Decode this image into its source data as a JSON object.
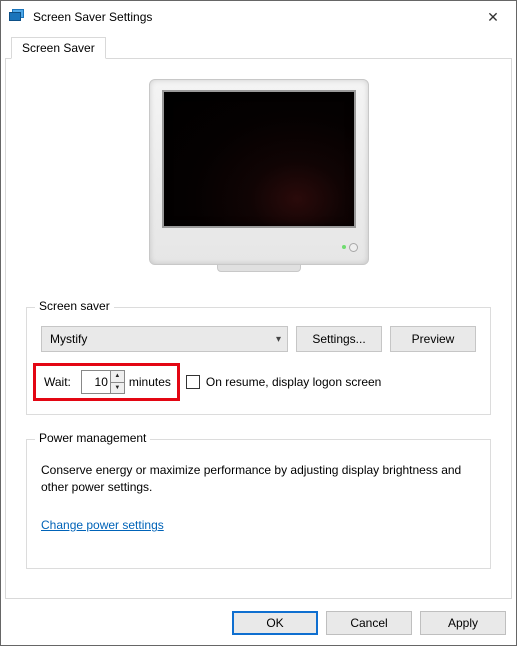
{
  "window": {
    "title": "Screen Saver Settings",
    "close_glyph": "✕"
  },
  "tab": {
    "label": "Screen Saver"
  },
  "saver_group": {
    "legend": "Screen saver",
    "selected": "Mystify",
    "settings_btn": "Settings...",
    "preview_btn": "Preview",
    "wait_label": "Wait:",
    "wait_value": "10",
    "wait_unit": "minutes",
    "resume_label": "On resume, display logon screen",
    "resume_checked": false
  },
  "power_group": {
    "legend": "Power management",
    "text": "Conserve energy or maximize performance by adjusting display brightness and other power settings.",
    "link": "Change power settings"
  },
  "buttons": {
    "ok": "OK",
    "cancel": "Cancel",
    "apply": "Apply"
  }
}
